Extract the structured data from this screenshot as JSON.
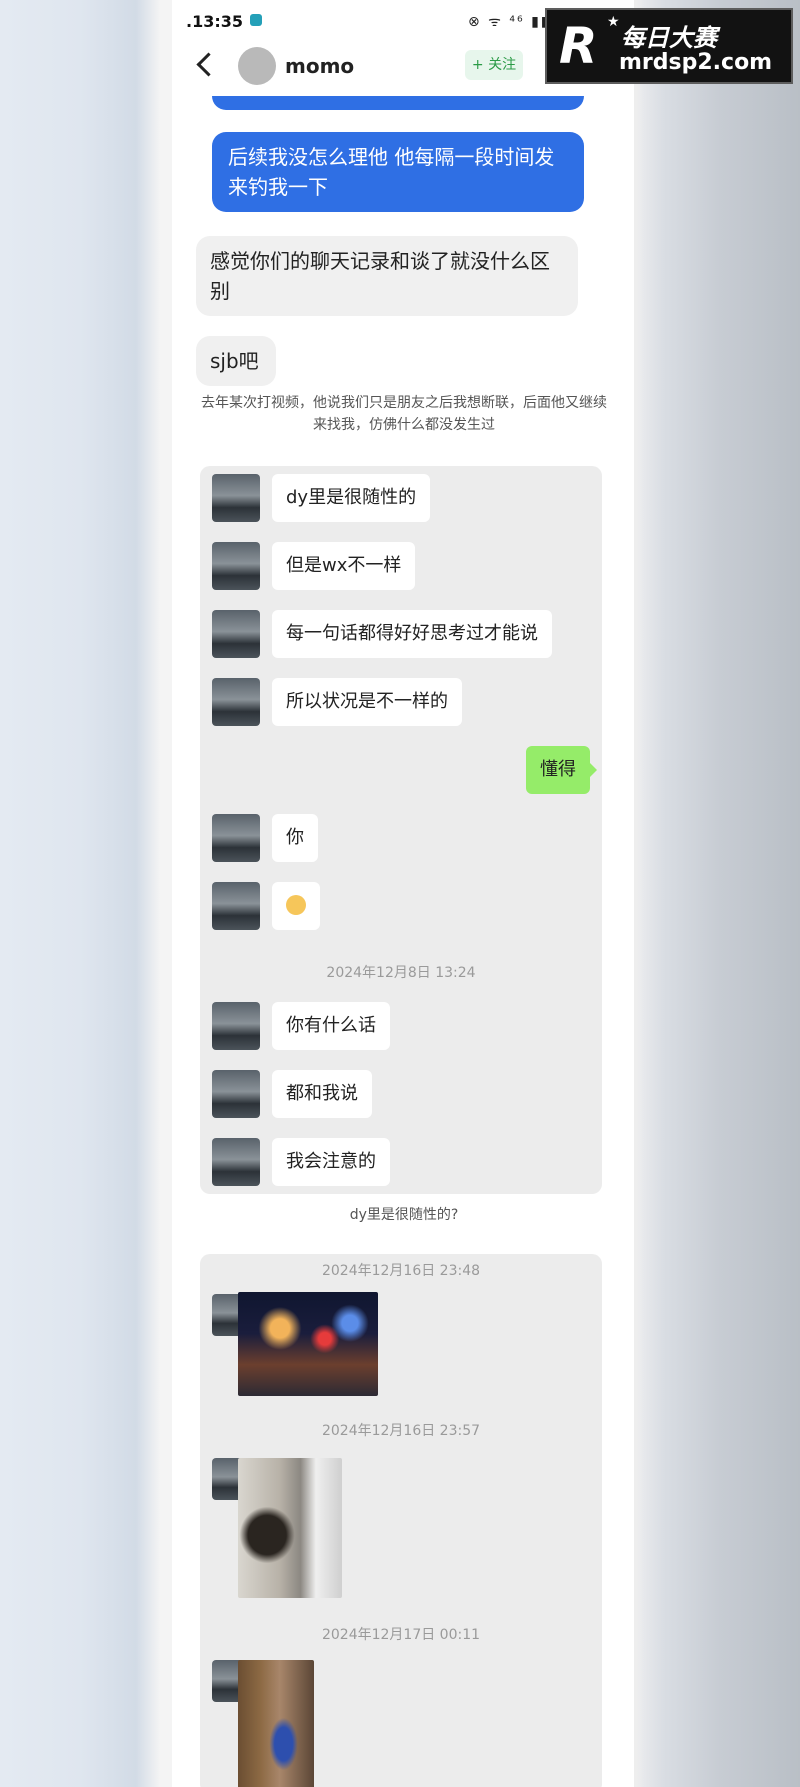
{
  "status_bar": {
    "time": ".13:35",
    "icons": "⊗ ᯤ ⁴⁶ ▮▮ ▭"
  },
  "nav": {
    "name": "momo",
    "follow_label": "+ 关注",
    "more_label": "···"
  },
  "watermark": {
    "logo": "R",
    "title": "每日大赛",
    "domain": "mrdsp2.com"
  },
  "messages": {
    "blue_1": "后续我没怎么理他 他每隔一段时间发来钓我一下",
    "gray_1": "感觉你们的聊天记录和谈了就没什么区别",
    "gray_2": "sjb吧"
  },
  "caption_1": "去年某次打视频，他说我们只是朋友之后我想断联，后面他又继续来找我，仿佛什么都没发生过",
  "wechat": {
    "msg_1": "dy里是很随性的",
    "msg_2": "但是wx不一样",
    "msg_3": "每一句话都得好好思考过才能说",
    "msg_4": "所以状况是不一样的",
    "self_msg": "懂得",
    "msg_5": "你",
    "msg_6_emoji": "frowning-face",
    "time_1": "2024年12月8日 13:24",
    "msg_7": "你有什么话",
    "msg_8": "都和我说",
    "msg_9": "我会注意的"
  },
  "caption_2": "dy里是很随性的?",
  "wechat_2": {
    "time_1": "2024年12月16日 23:48",
    "time_2": "2024年12月16日 23:57",
    "time_3": "2024年12月17日 00:11"
  },
  "colors": {
    "blue_bubble": "#2f6fe4",
    "wechat_green": "#95ec69",
    "follow_green": "#2b9b47"
  }
}
